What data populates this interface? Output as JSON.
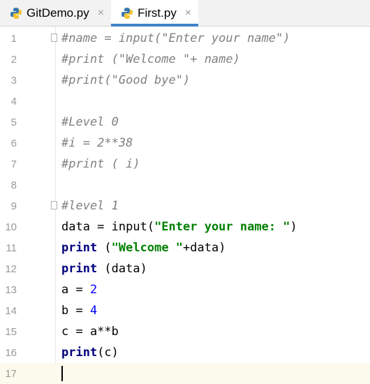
{
  "tabs": [
    {
      "label": "GitDemo.py",
      "close": "×"
    },
    {
      "label": "First.py",
      "close": "×"
    }
  ],
  "colors": {
    "accent": "#4083c9",
    "comment": "#808080",
    "keyword": "#000080",
    "string": "#008000",
    "number": "#0000ff",
    "current_line": "#fcfaed"
  },
  "editor": {
    "line_numbers": [
      "1",
      "2",
      "3",
      "4",
      "5",
      "6",
      "7",
      "8",
      "9",
      "10",
      "11",
      "12",
      "13",
      "14",
      "15",
      "16",
      "17"
    ],
    "lines": {
      "l1": "#name = input(\"Enter your name\")",
      "l2": "#print (\"Welcome \"+ name)",
      "l3": "#print(\"Good bye\")",
      "l5": "#Level 0",
      "l6": "#i = 2**38",
      "l7": "#print ( i)",
      "l9": "#level 1",
      "l10_a": "data = input(",
      "l10_b": "\"Enter your name: \"",
      "l10_c": ")",
      "l11_a": "print",
      "l11_b": " (",
      "l11_c": "\"Welcome \"",
      "l11_d": "+data)",
      "l12_a": "print",
      "l12_b": " (data)",
      "l13_a": "a = ",
      "l13_b": "2",
      "l14_a": "b = ",
      "l14_b": "4",
      "l15": "c = a**b",
      "l16_a": "print",
      "l16_b": "(c)"
    }
  }
}
